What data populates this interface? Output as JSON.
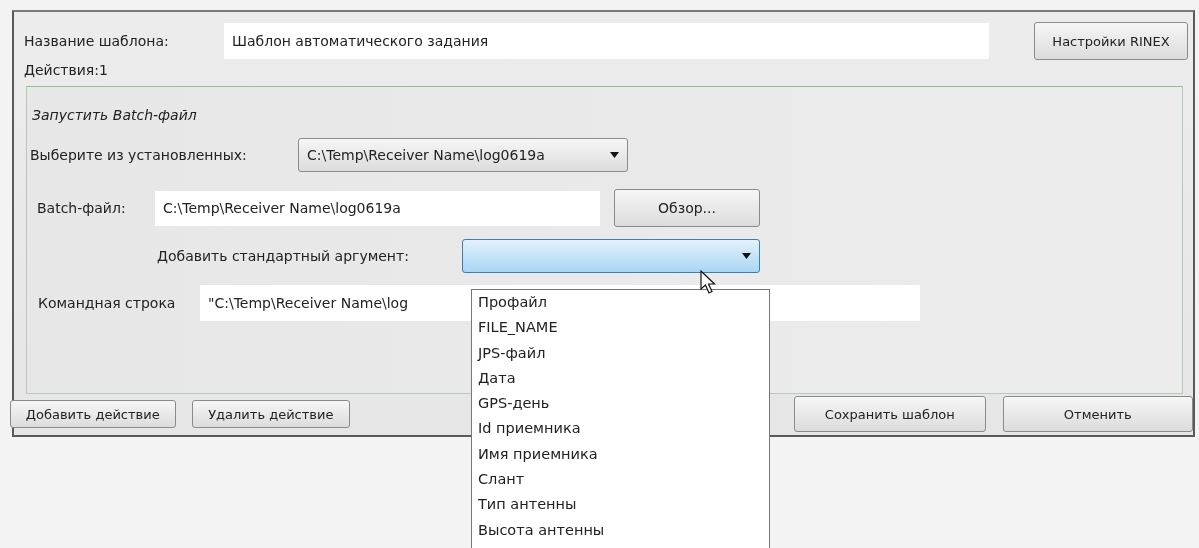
{
  "template_name": {
    "label": "Название шаблона:",
    "value": "Шаблон автоматического задания"
  },
  "rinex_button": "Настройки RINEX",
  "actions_count": "Действия:1",
  "action": {
    "title": "Запустить Batch-файл",
    "installed": {
      "label": "Выберите из установленных:",
      "value": "C:\\Temp\\Receiver Name\\log0619a"
    },
    "batch_file": {
      "label": "Batch-файл:",
      "value": "C:\\Temp\\Receiver Name\\log0619a"
    },
    "browse_button": "Обзор...",
    "argument": {
      "label": "Добавить стандартный аргумент:",
      "expanded": true,
      "options": [
        "Профайл",
        "FILE_NAME",
        "JPS-файл",
        "Дата",
        "GPS-день",
        "Id приемника",
        "Имя приемника",
        "Слант",
        "Тип антенны",
        "Высота антенны"
      ]
    },
    "command_line": {
      "label": "Командная строка",
      "value": "\"C:\\Temp\\Receiver Name\\log"
    }
  },
  "action_buttons": [
    "Добавить действие",
    "Удалить действие"
  ],
  "dialog_buttons": [
    "Сохранить шаблон",
    "Отменить"
  ]
}
